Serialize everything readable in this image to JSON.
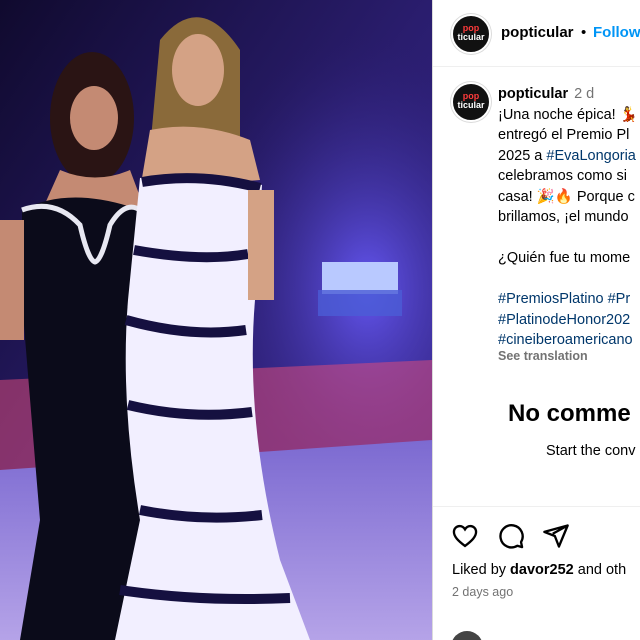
{
  "post": {
    "photo_alt": "photo",
    "account": {
      "username": "popticular",
      "logo_top": "pop",
      "logo_bottom": "ticular",
      "follow_label": "Follow",
      "separator": "•"
    },
    "caption": {
      "username": "popticular",
      "time": "2 d",
      "lines": [
        "¡Una noche épica! 💃",
        "entregó el Premio Pl",
        "2025 a ",
        "celebramos como si",
        "casa! 🎉🔥 Porque c",
        "brillamos, ¡el mundo",
        "",
        "¿Quién fue tu mome"
      ],
      "mention": "#EvaLongoria",
      "hashtag_lines": [
        "#PremiosPlatino #Pr",
        "#PlatinodeHonor202",
        "#cineiberoamericano"
      ]
    },
    "see_translation": "See translation",
    "no_comments": "No comme",
    "start_conversation": "Start the conv",
    "liked_by_prefix": "Liked by ",
    "liked_by_user": "davor252",
    "liked_by_suffix": " and oth",
    "posted_ago": "2 days ago"
  },
  "colors": {
    "link_blue": "#0095f6",
    "hashtag_blue": "#00376b",
    "muted_gray": "#737373",
    "stage_purple": "#3a2a8c"
  },
  "icons": [
    "heart-icon",
    "comment-icon",
    "share-icon"
  ]
}
